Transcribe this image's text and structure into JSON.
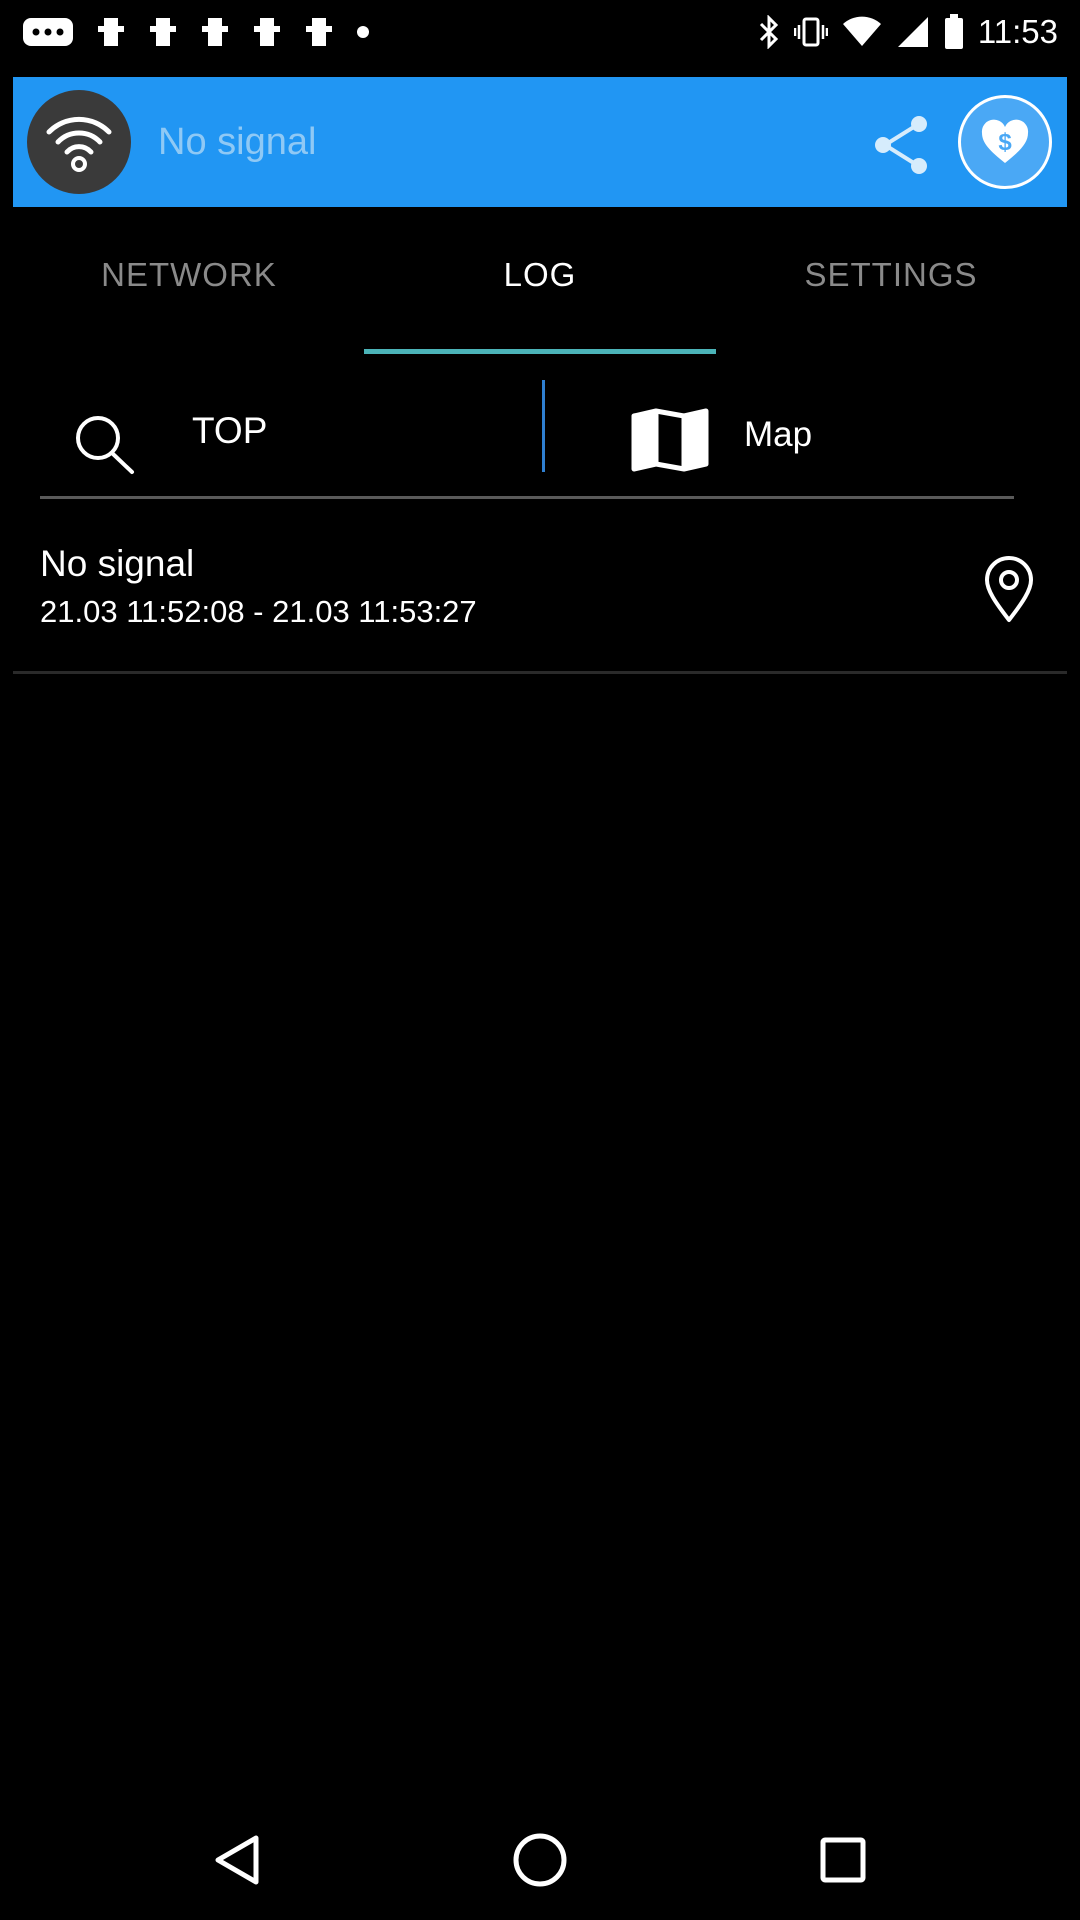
{
  "status_bar": {
    "time": "11:53",
    "left_icons": [
      "more-icon",
      "app-icon",
      "app-icon",
      "app-icon",
      "app-icon",
      "app-icon",
      "dot-icon"
    ],
    "right_icons": [
      "bluetooth-icon",
      "vibrate-icon",
      "wifi-status-icon",
      "signal-icon",
      "battery-icon"
    ]
  },
  "header": {
    "title": "No signal",
    "wifi_icon": "wifi-icon",
    "share_icon": "share-icon",
    "donate_icon": "heart-dollar-icon",
    "accent": "#2196f3"
  },
  "tabs": [
    {
      "label": "NETWORK",
      "active": false
    },
    {
      "label": "LOG",
      "active": true
    },
    {
      "label": "SETTINGS",
      "active": false
    }
  ],
  "filter": {
    "search_icon": "search-icon",
    "top_label": "TOP",
    "map_icon": "map-icon",
    "map_label": "Map"
  },
  "log": {
    "items": [
      {
        "title": "No signal",
        "time_range": "21.03 11:52:08 - 21.03 11:53:27",
        "icon": "location-pin-icon"
      }
    ]
  },
  "nav": {
    "back_icon": "back-icon",
    "home_icon": "home-icon",
    "recent_icon": "recent-apps-icon"
  }
}
